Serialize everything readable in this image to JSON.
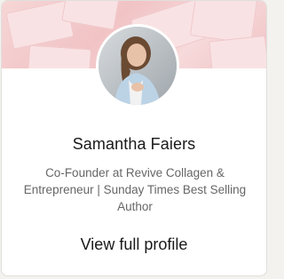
{
  "profile": {
    "name": "Samantha Faiers",
    "headline": "Co-Founder at Revive Collagen & Entrepreneur | Sunday Times Best Selling Author",
    "cta_label": "View full profile"
  },
  "colors": {
    "banner_pink": "#f1c3c5",
    "name_text": "#191919",
    "headline_text": "#666666"
  }
}
